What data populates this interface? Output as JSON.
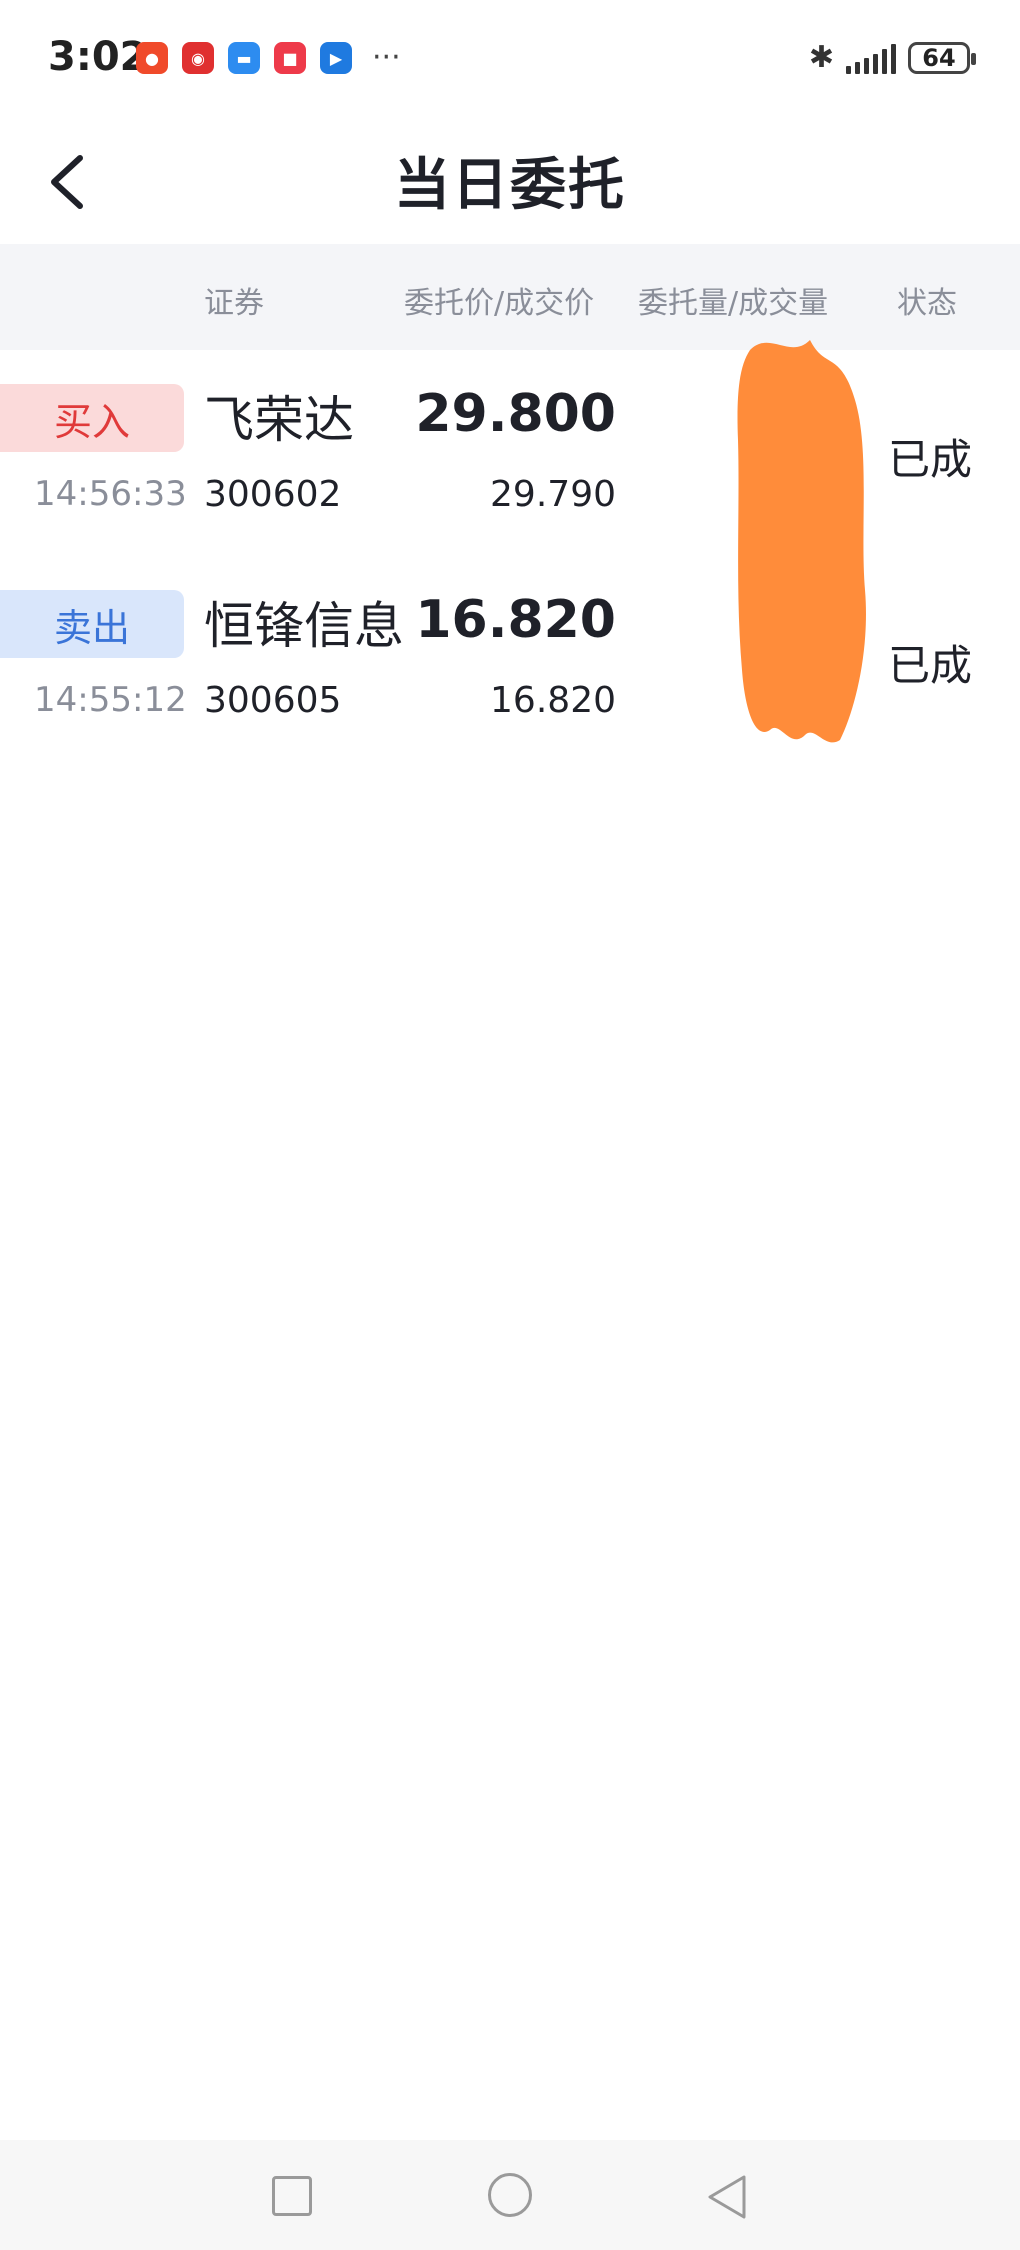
{
  "status_bar": {
    "time": "3:02",
    "battery": "64",
    "notification_icons": [
      {
        "name": "app-icon-1",
        "color": "#f04a2a"
      },
      {
        "name": "app-icon-2",
        "color": "#e03030"
      },
      {
        "name": "message-icon",
        "color": "#2d8cf0"
      },
      {
        "name": "app-icon-4",
        "color": "#ee3a4a"
      },
      {
        "name": "app-icon-5",
        "color": "#1f7ae0"
      }
    ],
    "more": "···"
  },
  "nav": {
    "title": "当日委托"
  },
  "table": {
    "headers": {
      "security": "证券",
      "price": "委托价/成交价",
      "volume": "委托量/成交量",
      "status": "状态"
    },
    "rows": [
      {
        "side": "买入",
        "side_type": "buy",
        "name": "飞荣达",
        "entrust_price": "29.800",
        "time": "14:56:33",
        "code": "300602",
        "deal_price": "29.790",
        "status": "已成"
      },
      {
        "side": "卖出",
        "side_type": "sell",
        "name": "恒锋信息",
        "entrust_price": "16.820",
        "time": "14:55:12",
        "code": "300605",
        "deal_price": "16.820",
        "status": "已成"
      }
    ]
  },
  "colors": {
    "buy": "#e03a3a",
    "sell": "#3a74d8",
    "redaction": "#ff8c3a"
  }
}
